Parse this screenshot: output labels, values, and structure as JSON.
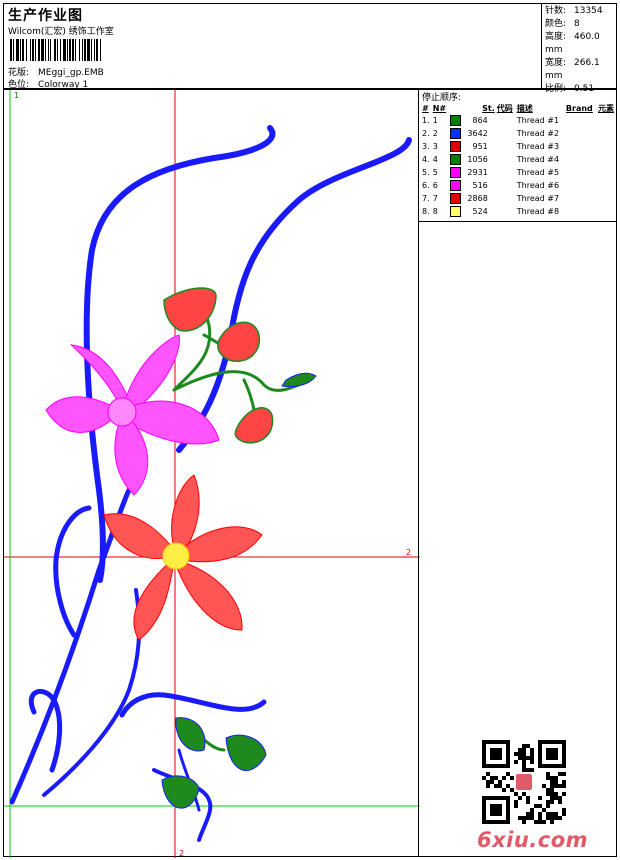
{
  "header": {
    "title": "生产作业图",
    "company": "Wilcom(汇宏) 绣饰工作室",
    "file_label": "花版:",
    "file_value": "MEggi_gp.EMB",
    "color_label": "色位:",
    "color_value": "Colorway 1"
  },
  "stats": [
    {
      "label": "针数:",
      "value": "13354"
    },
    {
      "label": "颜色:",
      "value": "8"
    },
    {
      "label": "高度:",
      "value": "460.0 mm"
    },
    {
      "label": "宽度:",
      "value": "266.1 mm"
    },
    {
      "label": "比例:",
      "value": "0.51"
    }
  ],
  "stop_sequence": {
    "title": "停止顺序:",
    "columns": [
      "#",
      "N#",
      "St.",
      "代码",
      "描述",
      "Brand",
      "元素"
    ],
    "rows": [
      {
        "seq": "1.",
        "n": "1",
        "color": "#007f00",
        "st": "864",
        "desc": "Thread #1"
      },
      {
        "seq": "2.",
        "n": "2",
        "color": "#0033ff",
        "st": "3642",
        "desc": "Thread #2"
      },
      {
        "seq": "3.",
        "n": "3",
        "color": "#e00000",
        "st": "951",
        "desc": "Thread #3"
      },
      {
        "seq": "4.",
        "n": "4",
        "color": "#007f00",
        "st": "1056",
        "desc": "Thread #4"
      },
      {
        "seq": "5.",
        "n": "5",
        "color": "#ff00ff",
        "st": "2931",
        "desc": "Thread #5"
      },
      {
        "seq": "6.",
        "n": "6",
        "color": "#ff00ff",
        "st": "516",
        "desc": "Thread #6"
      },
      {
        "seq": "7.",
        "n": "7",
        "color": "#e00000",
        "st": "2868",
        "desc": "Thread #7"
      },
      {
        "seq": "8.",
        "n": "8",
        "color": "#ffff66",
        "st": "524",
        "desc": "Thread #8"
      }
    ]
  },
  "design": {
    "guide_labels": {
      "top_left": "1",
      "right": "2",
      "bottom": "2"
    },
    "colors": {
      "stem": "#1a1aff",
      "leaf": "#1e8a1e",
      "petal_pink": "#ff33ff",
      "petal_red": "#ff3333",
      "center": "#ffee44",
      "guide_red": "#e00000",
      "guide_green": "#00cc00"
    }
  },
  "watermark": {
    "text": "6xiu.com"
  }
}
